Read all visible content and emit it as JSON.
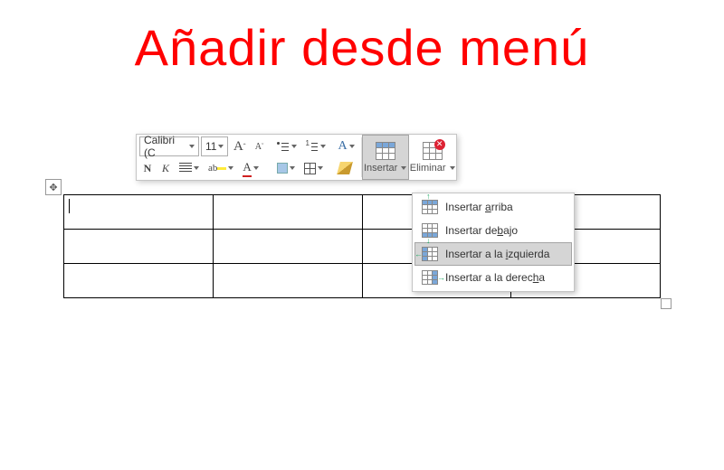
{
  "title": "Añadir desde menú",
  "toolbar": {
    "font_name": "Calibri (C",
    "font_size": "11",
    "bold": "N",
    "italic": "K",
    "insert_label": "Insertar",
    "delete_label": "Eliminar"
  },
  "menu": {
    "items": [
      {
        "label_pre": "Insertar ",
        "access": "a",
        "label_post": "rriba",
        "dir": "up"
      },
      {
        "label_pre": "Insertar de",
        "access": "b",
        "label_post": "ajo",
        "dir": "down"
      },
      {
        "label_pre": "Insertar a la ",
        "access": "i",
        "label_post": "zquierda",
        "dir": "left",
        "hover": true
      },
      {
        "label_pre": "Insertar a la derec",
        "access": "h",
        "label_post": "a",
        "dir": "right"
      }
    ]
  },
  "table": {
    "rows": 3,
    "cols": 4
  }
}
